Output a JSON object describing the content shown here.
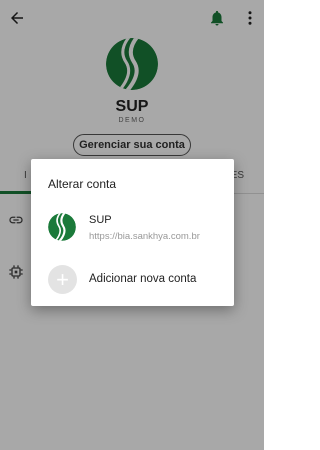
{
  "header": {
    "back_icon": "arrow-left-icon",
    "notification_icon": "bell-icon",
    "menu_icon": "more-vert-icon"
  },
  "profile": {
    "name": "SUP",
    "subtitle": "DEMO",
    "manage_label": "Gerenciar sua conta",
    "logo_color": "#1b7a3a"
  },
  "tabs": {
    "left_fragment": "I",
    "right_fragment": "ES"
  },
  "dialog": {
    "title": "Alterar conta",
    "account": {
      "name": "SUP",
      "url": "https://bia.sankhya.com.br"
    },
    "add_label": "Adicionar nova conta",
    "add_symbol": "+"
  },
  "colors": {
    "brand": "#1b7a3a",
    "scrim": "rgba(0,0,0,0.34)"
  }
}
